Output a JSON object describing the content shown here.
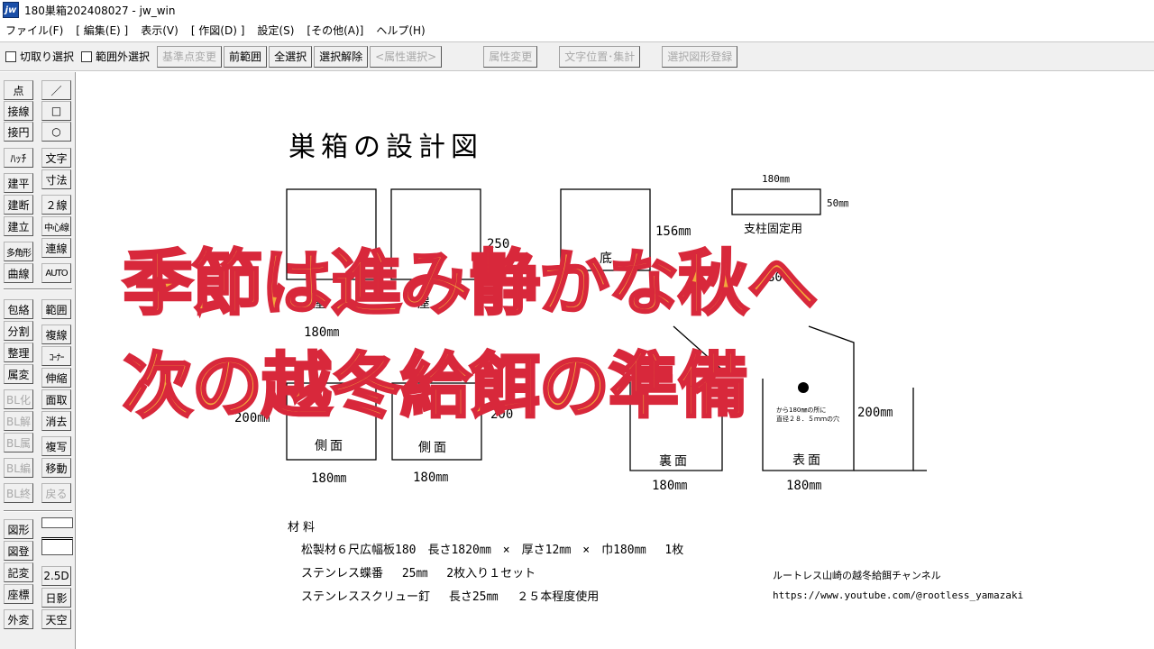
{
  "window": {
    "title": "180巣箱202408027 - jw_win",
    "icon_label": "jw"
  },
  "menu": [
    "ファイル(F)",
    "[ 編集(E) ]",
    "表示(V)",
    "[ 作図(D) ]",
    "設定(S)",
    "[その他(A)]",
    "ヘルプ(H)"
  ],
  "toolbar": {
    "check_cut": "切取り選択",
    "check_outside": "範囲外選択",
    "btn_base": "基準点変更",
    "btn_prev": "前範囲",
    "btn_all": "全選択",
    "btn_clear": "選択解除",
    "btn_attr_select": "<属性選択>",
    "btn_attr_change": "属性変更",
    "btn_text_pos": "文字位置･集計",
    "btn_register": "選択図形登録"
  },
  "palette": {
    "point": "点",
    "line": "／",
    "tangent": "接線",
    "rect": "□",
    "tancircle": "接円",
    "circle": "○",
    "hatch": "ﾊｯﾁ",
    "text": "文字",
    "kenpei": "建平",
    "dimension": "寸法",
    "kendan": "建断",
    "double": "２線",
    "kenritsu": "建立",
    "center": "中心線",
    "polygon": "多角形",
    "continuous": "連線",
    "curve": "曲線",
    "auto": "AUTO",
    "envelope": "包絡",
    "range": "範囲",
    "split": "分割",
    "multi": "複線",
    "arrange": "整理",
    "corner": "ｺｰﾅｰ",
    "attr": "属変",
    "stretch": "伸縮",
    "blk": "BL化",
    "area": "面取",
    "bldis": "BL解",
    "erase": "消去",
    "blattr": "BL属",
    "copy": "複写",
    "bledit": "BL編",
    "move": "移動",
    "blend": "BL終",
    "back": "戻る",
    "shape": "図形",
    "register": "図登",
    "record": "記変",
    "view25": "2.5D",
    "coord": "座標",
    "shadow": "日影",
    "outer": "外変",
    "sky": "天空"
  },
  "drawing": {
    "title": "巣箱の設計図",
    "dim_180_top": "180㎜",
    "dim_50": "50㎜",
    "support_label": "支柱固定用",
    "dim_250": "250",
    "dim_156": "156㎜",
    "dim_80": "80",
    "roof1": "屋",
    "roof2": "屋",
    "bottom_label": "底",
    "dim_180_a": "180㎜",
    "dim_200_left": "200㎜",
    "dim_200_mid": "200",
    "dim_200_right": "200㎜",
    "side_a": "側面",
    "side_b": "側面",
    "back_label": "裏面",
    "front_label": "表面",
    "dim_180_b": "180㎜",
    "dim_180_c": "180㎜",
    "dim_180_d": "180㎜",
    "dim_180_e": "180㎜",
    "hole_note_1": "から180㎜の所に",
    "hole_note_2": "直径２８．５ｍｍの穴",
    "materials_heading": "材料",
    "materials": [
      "松製材６尺広幅板180　長さ1820㎜　×　厚さ12㎜　×　巾180㎜　 1枚",
      "ステンレス蝶番　 25㎜　 2枚入り１セット",
      "ステンレススクリュー釘　 長さ25㎜　 ２５本程度使用"
    ],
    "channel": "ルートレス山崎の越冬給餌チャンネル",
    "url": "https://www.youtube.com/@rootless_yamazaki"
  },
  "overlay": {
    "line1": "季節は進み静かな秋へ",
    "line2": "次の越冬給餌の準備"
  },
  "colors": {
    "overlay_fill": "#f2a93b",
    "overlay_stroke": "#d8283b",
    "icon_bg": "#1b4fa8"
  }
}
